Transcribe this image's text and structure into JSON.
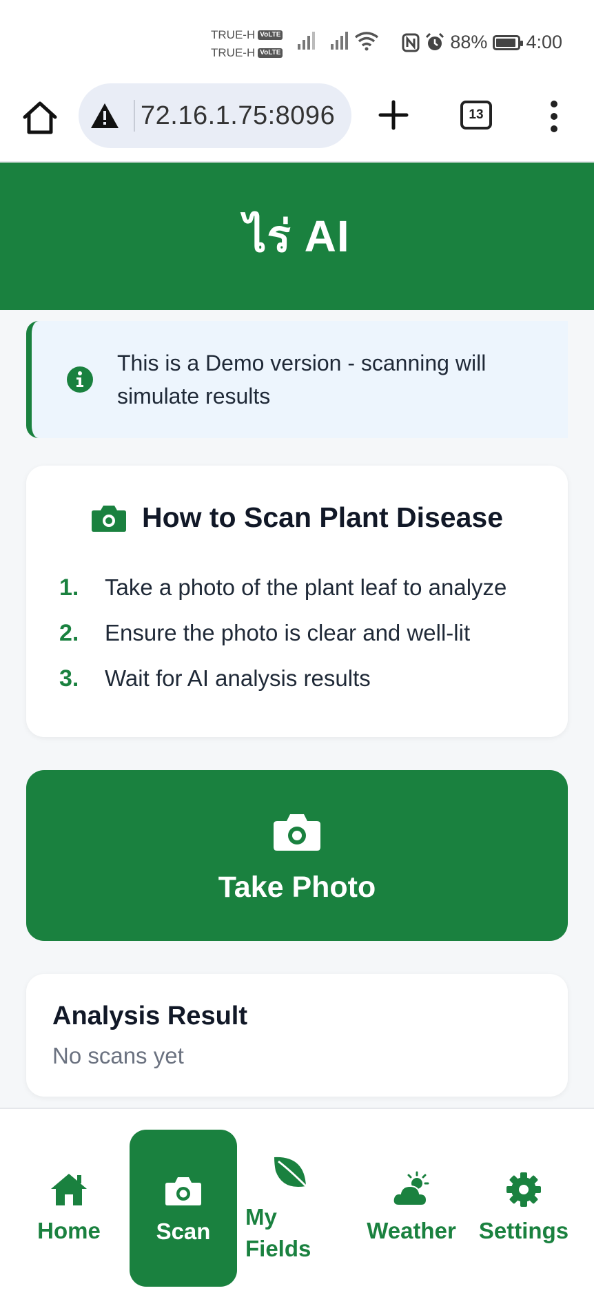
{
  "status_bar": {
    "carrier_1": "TRUE-H",
    "carrier_2": "TRUE-H",
    "volte_badge": "VoLTE",
    "battery": "88%",
    "time": "4:00"
  },
  "browser": {
    "url": "72.16.1.75:8096",
    "tab_count": "13"
  },
  "app": {
    "title": "ไร่ AI",
    "brand_color": "#1a813f"
  },
  "notice": {
    "text": "This is a Demo version - scanning will simulate results"
  },
  "instructions": {
    "title": "How to Scan Plant Disease",
    "steps": [
      {
        "num": "1.",
        "text": "Take a photo of the plant leaf to analyze"
      },
      {
        "num": "2.",
        "text": "Ensure the photo is clear and well-lit"
      },
      {
        "num": "3.",
        "text": "Wait for AI analysis results"
      }
    ]
  },
  "take_photo": {
    "label": "Take Photo"
  },
  "analysis": {
    "title": "Analysis Result",
    "empty_text": "No scans yet"
  },
  "bottom_nav": {
    "items": [
      {
        "label": "Home",
        "icon": "home-icon",
        "active": false
      },
      {
        "label": "Scan",
        "icon": "camera-icon",
        "active": true
      },
      {
        "label": "My Fields",
        "icon": "leaf-icon",
        "active": false
      },
      {
        "label": "Weather",
        "icon": "cloud-sun-icon",
        "active": false
      },
      {
        "label": "Settings",
        "icon": "gear-icon",
        "active": false
      }
    ]
  }
}
